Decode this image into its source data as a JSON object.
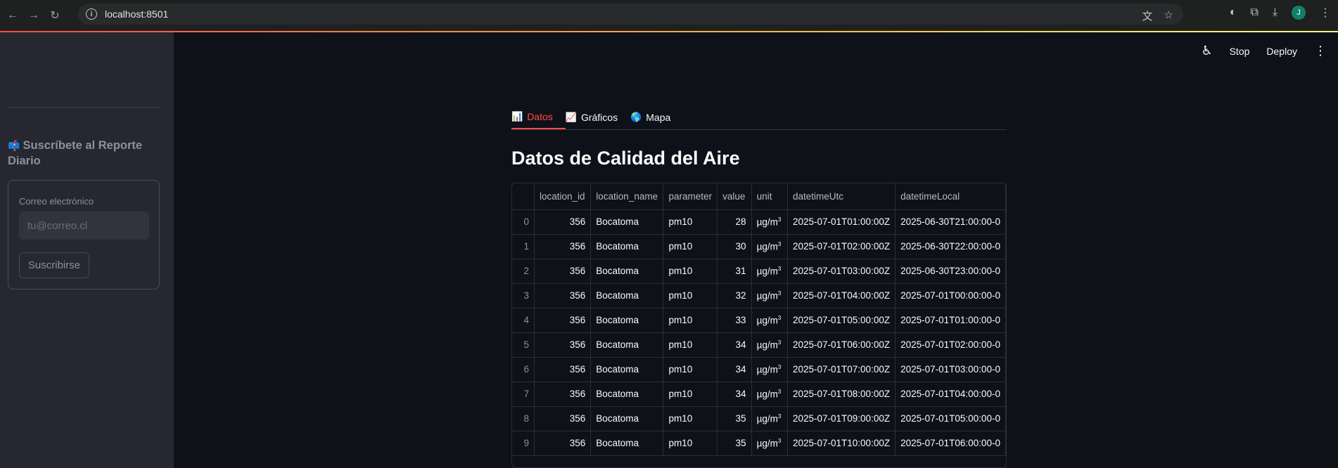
{
  "browser": {
    "url": "localhost:8501",
    "avatar_letter": "J"
  },
  "toolbar": {
    "stop_label": "Stop",
    "deploy_label": "Deploy"
  },
  "sidebar": {
    "subscribe_title": "Suscríbete al Reporte Diario",
    "email_label": "Correo electrónico",
    "email_placeholder": "tu@correo.cl",
    "email_value": "",
    "subscribe_button": "Suscribirse"
  },
  "tabs": [
    {
      "label": "Datos",
      "icon": "bar-chart-icon",
      "active": true
    },
    {
      "label": "Gráficos",
      "icon": "line-chart-icon",
      "active": false
    },
    {
      "label": "Mapa",
      "icon": "globe-icon",
      "active": false
    }
  ],
  "main": {
    "title": "Datos de Calidad del Aire"
  },
  "table": {
    "columns": [
      "",
      "location_id",
      "location_name",
      "parameter",
      "value",
      "unit",
      "datetimeUtc",
      "datetimeLocal"
    ],
    "rows": [
      {
        "idx": "0",
        "location_id": "356",
        "location_name": "Bocatoma",
        "parameter": "pm10",
        "value": "28",
        "unit": "µg/m",
        "datetimeUtc": "2025-07-01T01:00:00Z",
        "datetimeLocal": "2025-06-30T21:00:00-0"
      },
      {
        "idx": "1",
        "location_id": "356",
        "location_name": "Bocatoma",
        "parameter": "pm10",
        "value": "30",
        "unit": "µg/m",
        "datetimeUtc": "2025-07-01T02:00:00Z",
        "datetimeLocal": "2025-06-30T22:00:00-0"
      },
      {
        "idx": "2",
        "location_id": "356",
        "location_name": "Bocatoma",
        "parameter": "pm10",
        "value": "31",
        "unit": "µg/m",
        "datetimeUtc": "2025-07-01T03:00:00Z",
        "datetimeLocal": "2025-06-30T23:00:00-0"
      },
      {
        "idx": "3",
        "location_id": "356",
        "location_name": "Bocatoma",
        "parameter": "pm10",
        "value": "32",
        "unit": "µg/m",
        "datetimeUtc": "2025-07-01T04:00:00Z",
        "datetimeLocal": "2025-07-01T00:00:00-0"
      },
      {
        "idx": "4",
        "location_id": "356",
        "location_name": "Bocatoma",
        "parameter": "pm10",
        "value": "33",
        "unit": "µg/m",
        "datetimeUtc": "2025-07-01T05:00:00Z",
        "datetimeLocal": "2025-07-01T01:00:00-0"
      },
      {
        "idx": "5",
        "location_id": "356",
        "location_name": "Bocatoma",
        "parameter": "pm10",
        "value": "34",
        "unit": "µg/m",
        "datetimeUtc": "2025-07-01T06:00:00Z",
        "datetimeLocal": "2025-07-01T02:00:00-0"
      },
      {
        "idx": "6",
        "location_id": "356",
        "location_name": "Bocatoma",
        "parameter": "pm10",
        "value": "34",
        "unit": "µg/m",
        "datetimeUtc": "2025-07-01T07:00:00Z",
        "datetimeLocal": "2025-07-01T03:00:00-0"
      },
      {
        "idx": "7",
        "location_id": "356",
        "location_name": "Bocatoma",
        "parameter": "pm10",
        "value": "34",
        "unit": "µg/m",
        "datetimeUtc": "2025-07-01T08:00:00Z",
        "datetimeLocal": "2025-07-01T04:00:00-0"
      },
      {
        "idx": "8",
        "location_id": "356",
        "location_name": "Bocatoma",
        "parameter": "pm10",
        "value": "35",
        "unit": "µg/m",
        "datetimeUtc": "2025-07-01T09:00:00Z",
        "datetimeLocal": "2025-07-01T05:00:00-0"
      },
      {
        "idx": "9",
        "location_id": "356",
        "location_name": "Bocatoma",
        "parameter": "pm10",
        "value": "35",
        "unit": "µg/m",
        "datetimeUtc": "2025-07-01T10:00:00Z",
        "datetimeLocal": "2025-07-01T06:00:00-0"
      }
    ]
  },
  "colors": {
    "accent": "#ff4b4b",
    "background": "#0e1117",
    "sidebar": "#262730"
  }
}
